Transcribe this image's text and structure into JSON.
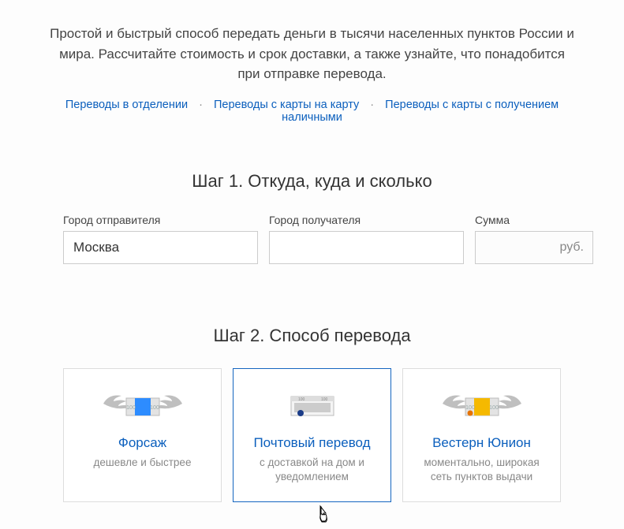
{
  "intro_text": "Простой и быстрый способ передать деньги в тысячи населенных пунктов России и мира. Рассчитайте стоимость и срок доставки, а также узнайте, что понадобится при отправке перевода.",
  "nav": {
    "link1": "Переводы в отделении",
    "link2": "Переводы с карты на карту",
    "link3": "Переводы с карты с получением наличными"
  },
  "step1": {
    "title": "Шаг 1. Откуда, куда и сколько",
    "sender_label": "Город отправителя",
    "sender_value": "Москва",
    "recipient_label": "Город получателя",
    "recipient_value": "",
    "sum_label": "Сумма",
    "sum_value": "",
    "currency": "руб."
  },
  "step2": {
    "title": "Шаг 2. Способ перевода",
    "methods": [
      {
        "name": "Форсаж",
        "sub": "дешевле и быстрее"
      },
      {
        "name": "Почтовый перевод",
        "sub": "с доставкой на дом и уведомлением"
      },
      {
        "name": "Вестерн Юнион",
        "sub": "моментально, широкая сеть пунктов выдачи"
      }
    ]
  }
}
